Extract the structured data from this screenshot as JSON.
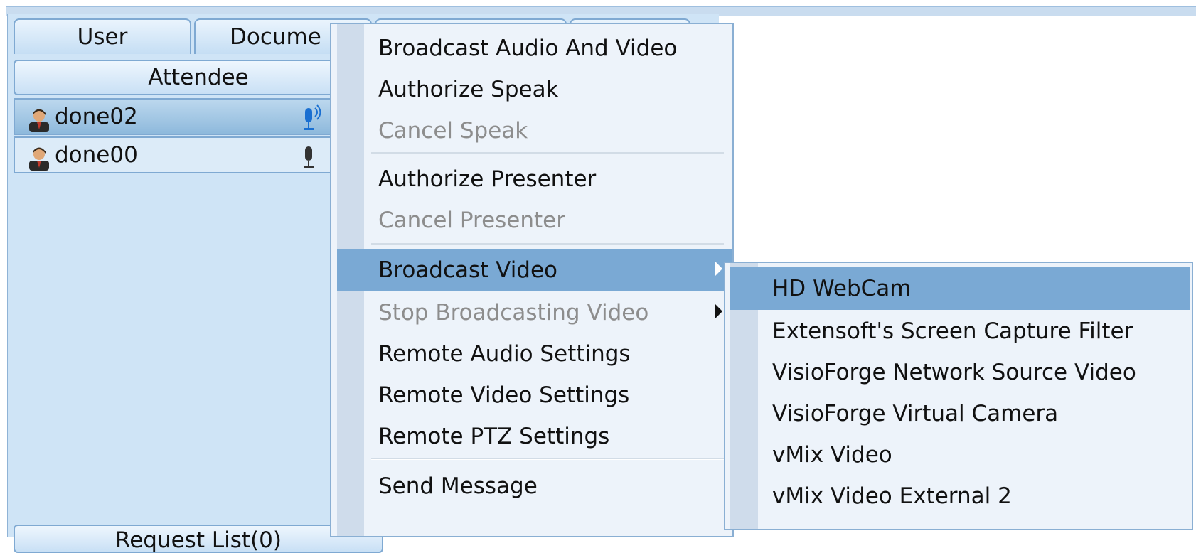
{
  "tabs": [
    {
      "label": "User"
    },
    {
      "label": "Docume"
    },
    {
      "label": ""
    },
    {
      "label": ""
    }
  ],
  "attendee_header": "Attendee",
  "users": [
    {
      "name": "done02",
      "selected": true,
      "mic_icon": "mic-active-icon"
    },
    {
      "name": "done00",
      "selected": false,
      "mic_icon": "mic-icon"
    }
  ],
  "request_list_label": "Request List(0)",
  "context_menu": {
    "items": [
      {
        "label": "Broadcast Audio And Video",
        "enabled": true
      },
      {
        "label": "Authorize Speak",
        "enabled": true
      },
      {
        "label": "Cancel Speak",
        "enabled": false
      },
      {
        "label": "Authorize Presenter",
        "enabled": true
      },
      {
        "label": "Cancel Presenter",
        "enabled": false
      },
      {
        "label": "Broadcast Video",
        "enabled": true,
        "highlighted": true,
        "submenu": true
      },
      {
        "label": "Stop Broadcasting Video",
        "enabled": false,
        "submenu": true
      },
      {
        "label": "Remote Audio Settings",
        "enabled": true
      },
      {
        "label": "Remote Video Settings",
        "enabled": true
      },
      {
        "label": "Remote PTZ Settings",
        "enabled": true
      },
      {
        "label": "Send Message",
        "enabled": true
      }
    ]
  },
  "video_submenu": {
    "items": [
      {
        "label": "HD WebCam",
        "highlighted": true
      },
      {
        "label": "Extensoft's Screen Capture Filter"
      },
      {
        "label": "VisioForge Network Source Video"
      },
      {
        "label": "VisioForge Virtual Camera"
      },
      {
        "label": "vMix Video"
      },
      {
        "label": "vMix Video External 2"
      }
    ]
  },
  "colors": {
    "highlight": "#7aa9d4",
    "panel": "#cfe4f6",
    "disabled_text": "#8d8d8d"
  }
}
